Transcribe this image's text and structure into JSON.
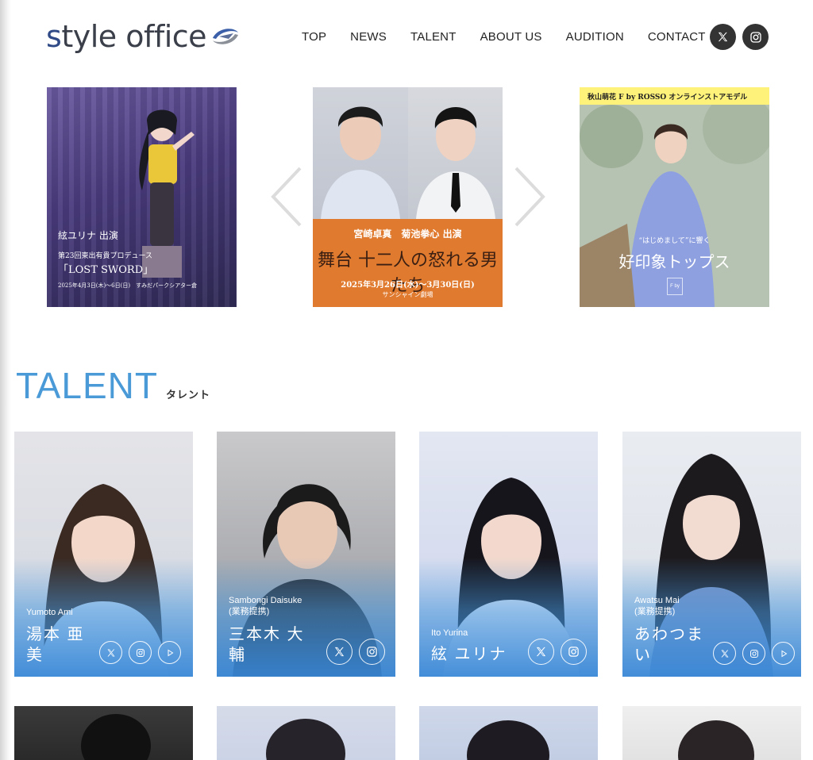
{
  "brand": {
    "logo_text_first": "s",
    "logo_text_rest": "tyle office"
  },
  "nav": {
    "items": [
      {
        "label": "TOP"
      },
      {
        "label": "NEWS"
      },
      {
        "label": "TALENT"
      },
      {
        "label": "ABOUT US"
      },
      {
        "label": "AUDITION"
      },
      {
        "label": "CONTACT"
      }
    ],
    "social": [
      {
        "icon": "x-icon"
      },
      {
        "icon": "instagram-icon"
      }
    ]
  },
  "carousel": {
    "slides": [
      {
        "line1": "絃ユリナ 出演",
        "line2": "第23回東出有貴プロデュース",
        "line3": "「LOST SWORD」",
        "line4": "2025年4月3日(木)〜6日(日)　すみだパークシアター倉"
      },
      {
        "names": "宮崎卓真　菊池拳心 出演",
        "title": "舞台 十二人の怒れる男たち",
        "date": "2025年3月26日(水)〜3月30日(日)",
        "venue": "サンシャイン劇場"
      },
      {
        "banner": "秋山萌花 F by ROSSO オンラインストアモデル",
        "line1": "“はじめまして”に響く",
        "line2": "好印象トップス",
        "mark": "F by"
      }
    ]
  },
  "talent": {
    "title": "TALENT",
    "subtitle": "タレント",
    "cards": [
      {
        "romaji": "Yumoto Ami",
        "name_line1": "湯本 亜",
        "name_line2": "美"
      },
      {
        "romaji": "Sambongi Daisuke",
        "romaji2": "(業務提携)",
        "name_line1": "三本木 大",
        "name_line2": "輔"
      },
      {
        "romaji": "Ito Yurina",
        "name_line1": "絃 ユリナ"
      },
      {
        "romaji": "Awatsu Mai",
        "romaji2": "(業務提携)",
        "name_line1": "あわつま",
        "name_line2": "い"
      }
    ]
  },
  "colors": {
    "accent": "#4a9ad8",
    "card_gradient": "#3787d7",
    "slide2_orange": "#e07a2e",
    "slide3_banner": "#fff27a"
  }
}
